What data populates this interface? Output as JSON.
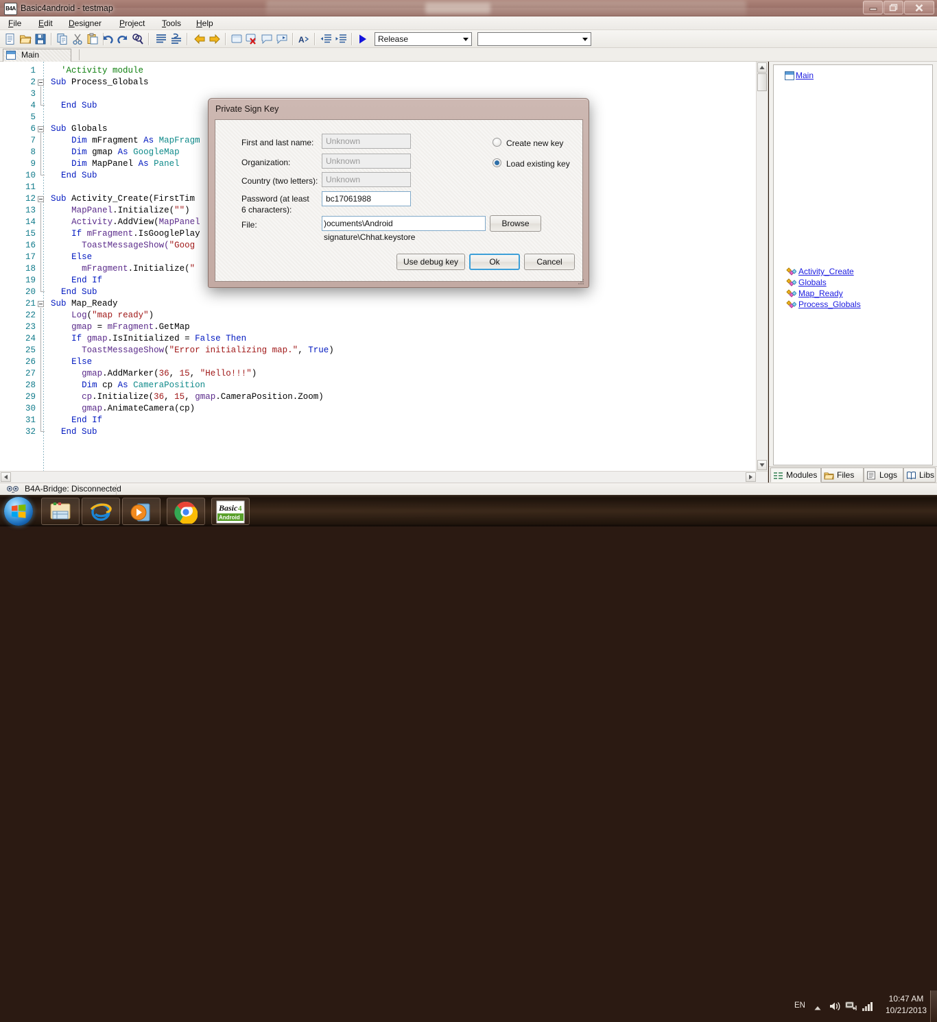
{
  "window": {
    "app_icon_text": "B4A",
    "title": "Basic4android - testmap",
    "buttons": {
      "minimize": "minimize-icon",
      "maximize": "restore-icon",
      "close": "close-icon"
    }
  },
  "menubar": {
    "items": [
      {
        "label": "File",
        "accel": "F"
      },
      {
        "label": "Edit",
        "accel": "E"
      },
      {
        "label": "Designer",
        "accel": "D"
      },
      {
        "label": "Project",
        "accel": "P"
      },
      {
        "label": "Tools",
        "accel": "T"
      },
      {
        "label": "Help",
        "accel": "H"
      }
    ]
  },
  "toolbar": {
    "icons": [
      "new-file-icon",
      "open-folder-icon",
      "save-icon",
      "copy-icon",
      "cut-icon",
      "paste-icon",
      "undo-icon",
      "redo-icon",
      "find-icon",
      "comment-block-icon",
      "uncomment-block-icon",
      "navigate-back-icon",
      "navigate-forward-icon",
      "add-breakpoint-icon",
      "remove-breakpoint-icon",
      "toggle-bookmark-icon",
      "goto-bookmark-icon",
      "change-case-icon",
      "outdent-icon",
      "indent-icon",
      "run-icon"
    ],
    "build_mode": "Release",
    "device_selector": ""
  },
  "tabstrip": {
    "tabs": [
      {
        "label": "Main",
        "icon": "module-icon",
        "active": true
      }
    ]
  },
  "editor": {
    "lines": [
      {
        "n": 1,
        "indent": 1,
        "fold": false,
        "tokens": [
          {
            "t": "'Activity module",
            "c": "cm"
          }
        ]
      },
      {
        "n": 2,
        "indent": 0,
        "fold": true,
        "tokens": [
          {
            "t": "Sub ",
            "c": "kw"
          },
          {
            "t": "Process_Globals",
            "c": ""
          }
        ]
      },
      {
        "n": 3,
        "indent": 0,
        "fold": false,
        "tokens": []
      },
      {
        "n": 4,
        "indent": 1,
        "fold": false,
        "tokens": [
          {
            "t": "End Sub",
            "c": "kw"
          }
        ]
      },
      {
        "n": 5,
        "indent": 0,
        "fold": false,
        "tokens": []
      },
      {
        "n": 6,
        "indent": 0,
        "fold": true,
        "tokens": [
          {
            "t": "Sub ",
            "c": "kw"
          },
          {
            "t": "Globals",
            "c": ""
          }
        ]
      },
      {
        "n": 7,
        "indent": 2,
        "fold": false,
        "tokens": [
          {
            "t": "Dim ",
            "c": "kw"
          },
          {
            "t": "mFragment ",
            "c": ""
          },
          {
            "t": "As ",
            "c": "kw"
          },
          {
            "t": "MapFragm",
            "c": "ty"
          }
        ]
      },
      {
        "n": 8,
        "indent": 2,
        "fold": false,
        "tokens": [
          {
            "t": "Dim ",
            "c": "kw"
          },
          {
            "t": "gmap ",
            "c": ""
          },
          {
            "t": "As ",
            "c": "kw"
          },
          {
            "t": "GoogleMap",
            "c": "ty"
          }
        ]
      },
      {
        "n": 9,
        "indent": 2,
        "fold": false,
        "tokens": [
          {
            "t": "Dim ",
            "c": "kw"
          },
          {
            "t": "MapPanel ",
            "c": ""
          },
          {
            "t": "As ",
            "c": "kw"
          },
          {
            "t": "Panel",
            "c": "ty"
          }
        ]
      },
      {
        "n": 10,
        "indent": 1,
        "fold": false,
        "tokens": [
          {
            "t": "End Sub",
            "c": "kw"
          }
        ]
      },
      {
        "n": 11,
        "indent": 0,
        "fold": false,
        "tokens": []
      },
      {
        "n": 12,
        "indent": 0,
        "fold": true,
        "tokens": [
          {
            "t": "Sub ",
            "c": "kw"
          },
          {
            "t": "Activity_Create(FirstTim",
            "c": ""
          }
        ]
      },
      {
        "n": 13,
        "indent": 2,
        "fold": false,
        "tokens": [
          {
            "t": "MapPanel",
            "c": "id"
          },
          {
            "t": ".Initialize(",
            "c": ""
          },
          {
            "t": "\"\"",
            "c": "st"
          },
          {
            "t": ")",
            "c": ""
          }
        ]
      },
      {
        "n": 14,
        "indent": 2,
        "fold": false,
        "tokens": [
          {
            "t": "Activity",
            "c": "id"
          },
          {
            "t": ".AddView(",
            "c": ""
          },
          {
            "t": "MapPanel",
            "c": "id"
          }
        ]
      },
      {
        "n": 15,
        "indent": 2,
        "fold": false,
        "tokens": [
          {
            "t": "If ",
            "c": "kw"
          },
          {
            "t": "mFragment",
            "c": "id"
          },
          {
            "t": ".IsGooglePlay",
            "c": ""
          }
        ]
      },
      {
        "n": 16,
        "indent": 3,
        "fold": false,
        "tokens": [
          {
            "t": "ToastMessageShow(",
            "c": "id"
          },
          {
            "t": "\"Goog",
            "c": "st"
          }
        ]
      },
      {
        "n": 17,
        "indent": 2,
        "fold": false,
        "tokens": [
          {
            "t": "Else",
            "c": "kw"
          }
        ]
      },
      {
        "n": 18,
        "indent": 3,
        "fold": false,
        "tokens": [
          {
            "t": "mFragment",
            "c": "id"
          },
          {
            "t": ".Initialize(",
            "c": ""
          },
          {
            "t": "\"",
            "c": "st"
          }
        ]
      },
      {
        "n": 19,
        "indent": 2,
        "fold": false,
        "tokens": [
          {
            "t": "End If",
            "c": "kw"
          }
        ]
      },
      {
        "n": 20,
        "indent": 1,
        "fold": false,
        "tokens": [
          {
            "t": "End Sub",
            "c": "kw"
          }
        ]
      },
      {
        "n": 21,
        "indent": 0,
        "fold": true,
        "tokens": [
          {
            "t": "Sub ",
            "c": "kw"
          },
          {
            "t": "Map_Ready",
            "c": ""
          }
        ]
      },
      {
        "n": 22,
        "indent": 2,
        "fold": false,
        "tokens": [
          {
            "t": "Log",
            "c": "id"
          },
          {
            "t": "(",
            "c": ""
          },
          {
            "t": "\"map ready\"",
            "c": "st"
          },
          {
            "t": ")",
            "c": ""
          }
        ]
      },
      {
        "n": 23,
        "indent": 2,
        "fold": false,
        "tokens": [
          {
            "t": "gmap",
            "c": "id"
          },
          {
            "t": " = ",
            "c": ""
          },
          {
            "t": "mFragment",
            "c": "id"
          },
          {
            "t": ".GetMap",
            "c": ""
          }
        ]
      },
      {
        "n": 24,
        "indent": 2,
        "fold": false,
        "tokens": [
          {
            "t": "If ",
            "c": "kw"
          },
          {
            "t": "gmap",
            "c": "id"
          },
          {
            "t": ".IsInitialized = ",
            "c": ""
          },
          {
            "t": "False Then",
            "c": "kw"
          }
        ]
      },
      {
        "n": 25,
        "indent": 3,
        "fold": false,
        "tokens": [
          {
            "t": "ToastMessageShow",
            "c": "id"
          },
          {
            "t": "(",
            "c": ""
          },
          {
            "t": "\"Error initializing map.\"",
            "c": "st"
          },
          {
            "t": ", ",
            "c": ""
          },
          {
            "t": "True",
            "c": "kw"
          },
          {
            "t": ")",
            "c": ""
          }
        ]
      },
      {
        "n": 26,
        "indent": 2,
        "fold": false,
        "tokens": [
          {
            "t": "Else",
            "c": "kw"
          }
        ]
      },
      {
        "n": 27,
        "indent": 3,
        "fold": false,
        "tokens": [
          {
            "t": "gmap",
            "c": "id"
          },
          {
            "t": ".AddMarker(",
            "c": ""
          },
          {
            "t": "36",
            "c": "nm"
          },
          {
            "t": ", ",
            "c": ""
          },
          {
            "t": "15",
            "c": "nm"
          },
          {
            "t": ", ",
            "c": ""
          },
          {
            "t": "\"Hello!!!\"",
            "c": "st"
          },
          {
            "t": ")",
            "c": ""
          }
        ]
      },
      {
        "n": 28,
        "indent": 3,
        "fold": false,
        "tokens": [
          {
            "t": "Dim ",
            "c": "kw"
          },
          {
            "t": "cp ",
            "c": ""
          },
          {
            "t": "As ",
            "c": "kw"
          },
          {
            "t": "CameraPosition",
            "c": "ty"
          }
        ]
      },
      {
        "n": 29,
        "indent": 3,
        "fold": false,
        "tokens": [
          {
            "t": "cp",
            "c": "id"
          },
          {
            "t": ".Initialize(",
            "c": ""
          },
          {
            "t": "36",
            "c": "nm"
          },
          {
            "t": ", ",
            "c": ""
          },
          {
            "t": "15",
            "c": "nm"
          },
          {
            "t": ", ",
            "c": ""
          },
          {
            "t": "gmap",
            "c": "id"
          },
          {
            "t": ".CameraPosition.Zoom)",
            "c": ""
          }
        ]
      },
      {
        "n": 30,
        "indent": 3,
        "fold": false,
        "tokens": [
          {
            "t": "gmap",
            "c": "id"
          },
          {
            "t": ".AnimateCamera(cp)",
            "c": ""
          }
        ]
      },
      {
        "n": 31,
        "indent": 2,
        "fold": false,
        "tokens": [
          {
            "t": "End If",
            "c": "kw"
          }
        ]
      },
      {
        "n": 32,
        "indent": 1,
        "fold": false,
        "tokens": [
          {
            "t": "End Sub",
            "c": "kw"
          }
        ]
      }
    ]
  },
  "right_panel": {
    "modules": [
      {
        "label": "Main",
        "icon": "module-icon"
      }
    ],
    "subs": [
      {
        "label": "Activity_Create",
        "icon": "sub-icon"
      },
      {
        "label": "Globals",
        "icon": "sub-icon"
      },
      {
        "label": "Map_Ready",
        "icon": "sub-icon"
      },
      {
        "label": "Process_Globals",
        "icon": "sub-icon"
      }
    ],
    "tabs": [
      {
        "label": "Modules",
        "icon": "modules-icon",
        "active": true
      },
      {
        "label": "Files",
        "icon": "folder-icon",
        "active": false
      },
      {
        "label": "Logs",
        "icon": "logs-icon",
        "active": false
      },
      {
        "label": "Libs",
        "icon": "book-icon",
        "active": false
      }
    ]
  },
  "statusbar": {
    "bridge_status": "B4A-Bridge: Disconnected",
    "icon": "bridge-icon"
  },
  "dialog": {
    "title": "Private Sign Key",
    "fields": [
      {
        "label": "First and last name:",
        "value": "Unknown",
        "placeholder": "Unknown",
        "filled": false
      },
      {
        "label": "Organization:",
        "value": "Unknown",
        "placeholder": "Unknown",
        "filled": false
      },
      {
        "label": "Country (two letters):",
        "value": "Unknown",
        "placeholder": "Unknown",
        "filled": false
      },
      {
        "label": "Password (at least",
        "label2": "6 characters):",
        "value": "bc17061988",
        "placeholder": "",
        "filled": true
      }
    ],
    "file_label": "File:",
    "file_value": ")ocuments\\Android signature\\Chhat.keystore",
    "browse_label": "Browse",
    "radios": [
      {
        "label": "Create new key",
        "selected": false
      },
      {
        "label": "Load existing key",
        "selected": true
      }
    ],
    "buttons": [
      {
        "label": "Use debug key",
        "default": false
      },
      {
        "label": "Ok",
        "default": true
      },
      {
        "label": "Cancel",
        "default": false
      }
    ]
  },
  "taskbar": {
    "start_icon": "windows-start-orb-icon",
    "buttons": [
      {
        "name": "explorer",
        "icon": "folder-explorer-icon"
      },
      {
        "name": "ie",
        "icon": "internet-explorer-icon"
      },
      {
        "name": "mediaplayer",
        "icon": "windows-media-player-icon"
      },
      {
        "name": "chrome",
        "icon": "google-chrome-icon"
      },
      {
        "name": "b4a",
        "icon": "basic4android-icon",
        "label": "Basic4\nAndroid"
      }
    ],
    "tray": {
      "language": "EN",
      "icons": [
        "show-hidden-icons-chevron",
        "volume-icon",
        "network-icon",
        "signal-bars-icon"
      ],
      "time": "10:47 AM",
      "date": "10/21/2013"
    }
  },
  "colors": {
    "accent_blue": "#3c9fd8",
    "link_blue": "#1a1ae0",
    "keyword_blue": "#0018c0",
    "comment_green": "#108010",
    "type_teal": "#0f8a8a",
    "string_red": "#a01818",
    "linenum_teal": "#0f7a8a",
    "dialog_frame": "#c3aaa3"
  }
}
